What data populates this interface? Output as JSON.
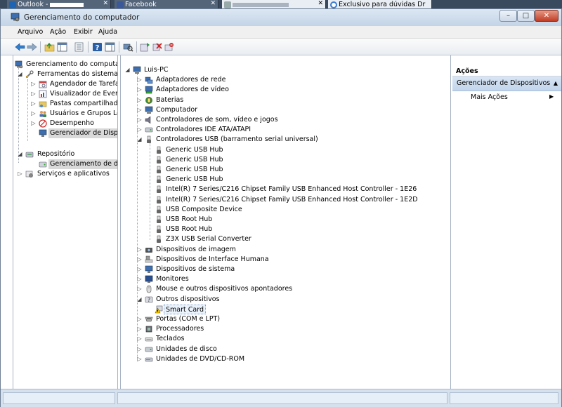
{
  "browser_tabs": [
    {
      "label": "Outlook -",
      "icon": "outlook-icon"
    },
    {
      "label": "Facebook",
      "icon": "facebook-icon"
    },
    {
      "label": "",
      "icon": "page-icon"
    },
    {
      "label": "Exclusivo para dúvidas Dr",
      "icon": "loading-icon"
    }
  ],
  "window": {
    "title": "Gerenciamento do computador",
    "buttons": {
      "minimize": "–",
      "maximize": "□",
      "close": "✕"
    }
  },
  "menu": [
    "Arquivo",
    "Ação",
    "Exibir",
    "Ajuda"
  ],
  "toolbar_icons": [
    "back-arrow-icon",
    "forward-arrow-icon",
    "up-folder-icon",
    "show-hide-tree-icon",
    "export-list-icon",
    "help-icon",
    "show-hide-action-pane-icon",
    "scan-hardware-icon",
    "update-driver-icon",
    "disable-device-icon",
    "uninstall-device-icon"
  ],
  "left_tree": {
    "root": "Gerenciamento do computado",
    "system_tools": "Ferramentas do sistema",
    "system_items": [
      {
        "label": "Agendador de Tarefas",
        "icon": "task-scheduler-icon"
      },
      {
        "label": "Visualizador de Eventos",
        "icon": "event-viewer-icon"
      },
      {
        "label": "Pastas compartilhadas",
        "icon": "shared-folder-icon"
      },
      {
        "label": "Usuários e Grupos Loca",
        "icon": "users-icon"
      },
      {
        "label": "Desempenho",
        "icon": "performance-icon"
      },
      {
        "label": "Gerenciador de Disposit",
        "icon": "device-manager-icon"
      }
    ],
    "storage": "Repositório",
    "storage_items": [
      {
        "label": "Gerenciamento de disco",
        "icon": "disk-management-icon"
      }
    ],
    "services": "Serviços e aplicativos"
  },
  "device_tree": {
    "computer": "Luis-PC",
    "categories_a": [
      {
        "label": "Adaptadores de rede",
        "icon": "network-adapter-icon"
      },
      {
        "label": "Adaptadores de vídeo",
        "icon": "display-adapter-icon"
      },
      {
        "label": "Baterias",
        "icon": "battery-icon"
      },
      {
        "label": "Computador",
        "icon": "computer-icon"
      },
      {
        "label": "Controladores de som, vídeo e jogos",
        "icon": "sound-icon"
      },
      {
        "label": "Controladores IDE ATA/ATAPI",
        "icon": "ide-controller-icon"
      }
    ],
    "usb_category": "Controladores USB (barramento serial universal)",
    "usb_devices": [
      "Generic USB Hub",
      "Generic USB Hub",
      "Generic USB Hub",
      "Generic USB Hub",
      "Intel(R) 7 Series/C216 Chipset Family USB Enhanced Host Controller - 1E26",
      "Intel(R) 7 Series/C216 Chipset Family USB Enhanced Host Controller - 1E2D",
      "USB Composite Device",
      "USB Root Hub",
      "USB Root Hub",
      "Z3X USB Serial Converter"
    ],
    "categories_b": [
      {
        "label": "Dispositivos de imagem",
        "icon": "imaging-device-icon"
      },
      {
        "label": "Dispositivos de Interface Humana",
        "icon": "hid-icon"
      },
      {
        "label": "Dispositivos de sistema",
        "icon": "system-device-icon"
      },
      {
        "label": "Monitores",
        "icon": "monitor-icon"
      },
      {
        "label": "Mouse e outros dispositivos apontadores",
        "icon": "mouse-icon"
      }
    ],
    "other_category": "Outros dispositivos",
    "other_devices": [
      {
        "label": "Smart Card",
        "icon": "warning-device-icon"
      }
    ],
    "categories_c": [
      {
        "label": "Portas (COM e LPT)",
        "icon": "port-icon"
      },
      {
        "label": "Processadores",
        "icon": "processor-icon"
      },
      {
        "label": "Teclados",
        "icon": "keyboard-icon"
      },
      {
        "label": "Unidades de disco",
        "icon": "disk-drive-icon"
      },
      {
        "label": "Unidades de DVD/CD-ROM",
        "icon": "dvd-drive-icon"
      }
    ]
  },
  "actions": {
    "header": "Ações",
    "section": "Gerenciador de Dispositivos",
    "more": "Mais Ações"
  }
}
